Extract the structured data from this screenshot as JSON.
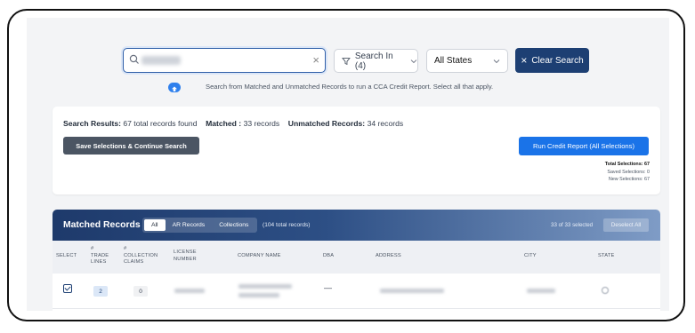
{
  "search": {
    "placeholder": "",
    "clear_icon": "close-icon",
    "search_in_label": "Search In (4)",
    "state_select_value": "All States",
    "clear_search_label": "Clear Search",
    "help_text": "Search from Matched and Unmatched Records to run a CCA Credit Report. Select all that apply."
  },
  "results": {
    "results_label": "Search Results:",
    "results_value": "67 total records found",
    "matched_label": "Matched :",
    "matched_value": "33 records",
    "unmatched_label": "Unmatched Records:",
    "unmatched_value": "34 records",
    "save_button": "Save Selections & Continue Search",
    "run_button": "Run Credit Report (All Selections)",
    "total_selections": "Total Selections: 67",
    "saved_selections": "Saved Selections: 0",
    "new_selections": "New Selections: 67"
  },
  "matched": {
    "title": "Matched Records",
    "tabs": [
      "All",
      "AR Records",
      "Collections"
    ],
    "total_records": "(104 total records)",
    "selected_count": "33 of 33 selected",
    "deselect_all": "Deselect All",
    "columns": {
      "select": "SELECT",
      "trade_lines": [
        "#",
        "TRADE",
        "LINES"
      ],
      "collection_claims": [
        "#",
        "COLLECTION",
        "CLAIMS"
      ],
      "license_number": [
        "LICENSE",
        "NUMBER"
      ],
      "company_name": "COMPANY NAME",
      "dba": "DBA",
      "address": "ADDRESS",
      "city": "CITY",
      "state": "STATE"
    },
    "rows": [
      {
        "trade_lines": "2",
        "collection_claims": "0",
        "dba": "—"
      }
    ]
  }
}
